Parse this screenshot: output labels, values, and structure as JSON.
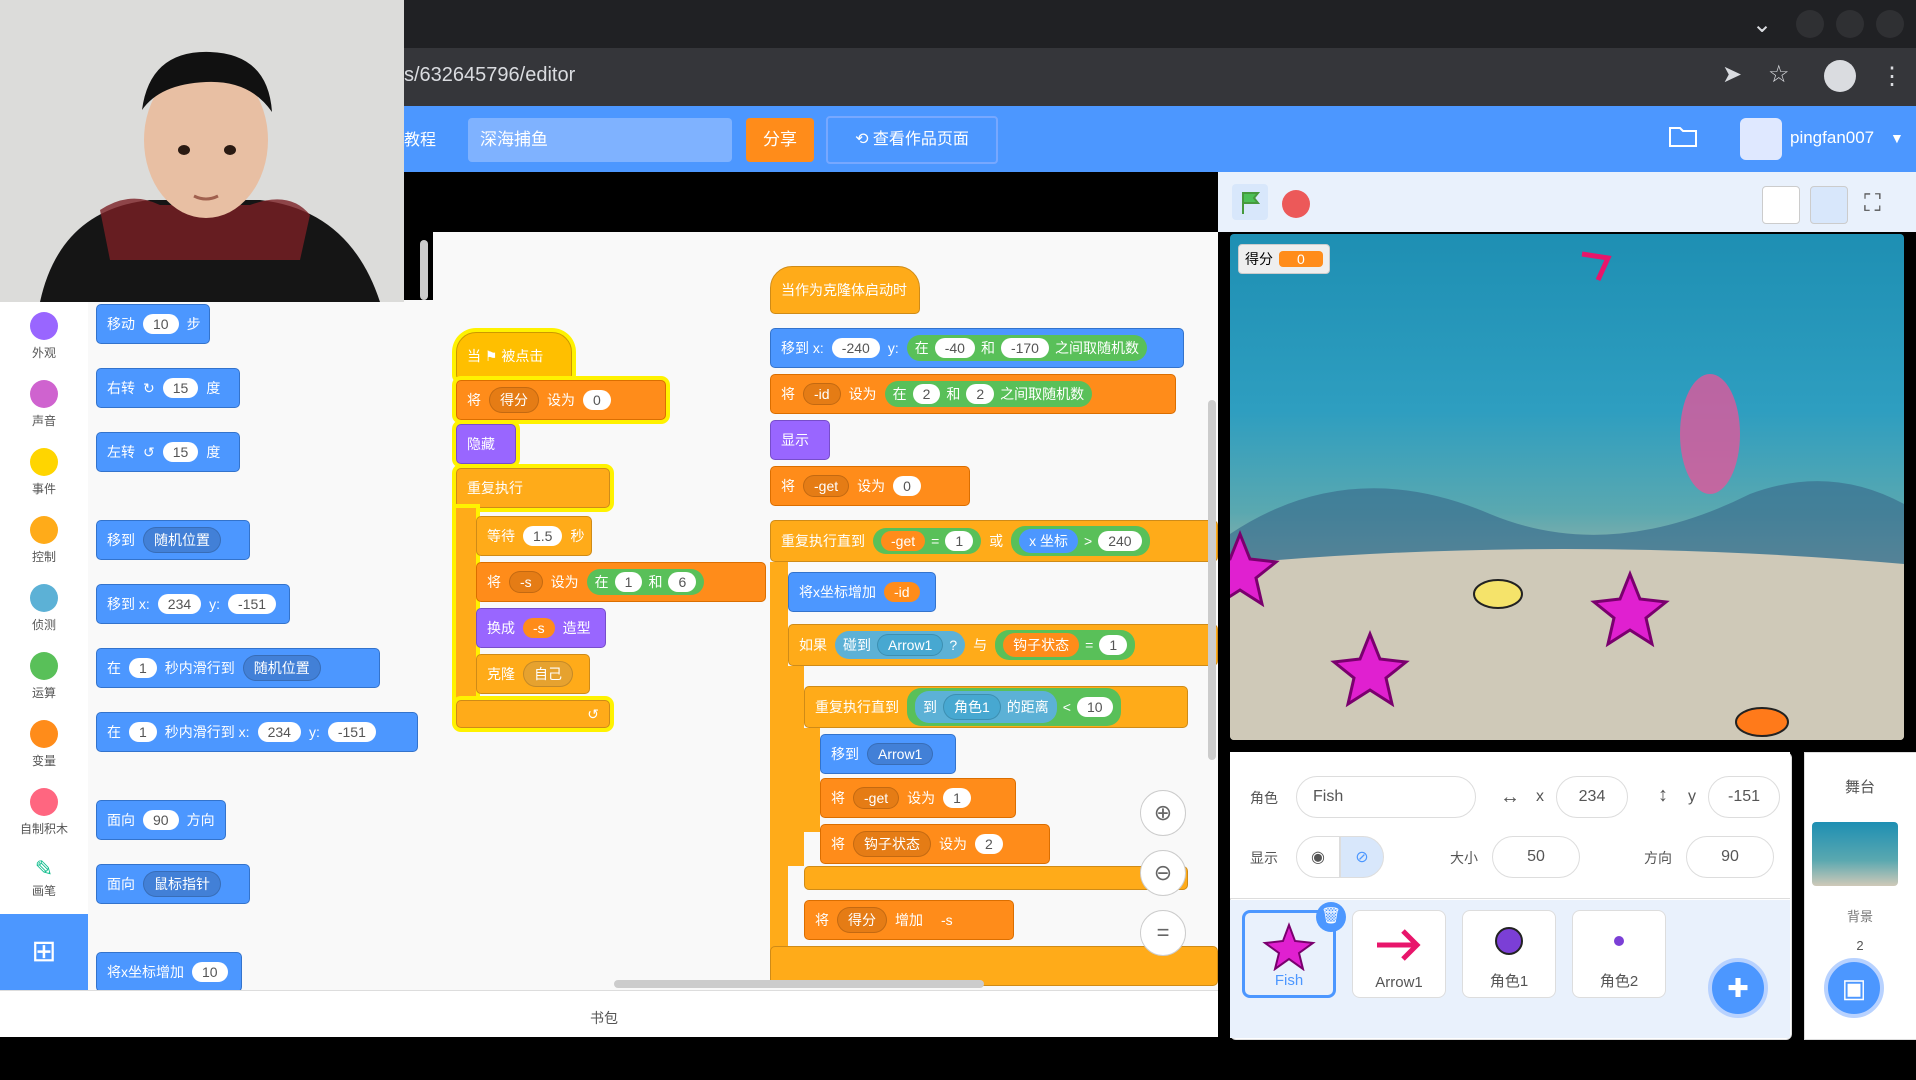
{
  "browser": {
    "url": "s/632645796/editor"
  },
  "menubar": {
    "tutorial": "教程",
    "project_title": "深海捕鱼",
    "share": "分享",
    "see_page": "查看作品页面",
    "username": "pingfan007"
  },
  "categories": [
    {
      "label": "外观",
      "color": "#9966ff"
    },
    {
      "label": "声音",
      "color": "#cf63cf"
    },
    {
      "label": "事件",
      "color": "#ffd500"
    },
    {
      "label": "控制",
      "color": "#ffab19"
    },
    {
      "label": "侦测",
      "color": "#5cb1d6"
    },
    {
      "label": "运算",
      "color": "#59c059"
    },
    {
      "label": "变量",
      "color": "#ff8c1a"
    },
    {
      "label": "自制积木",
      "color": "#ff6680"
    },
    {
      "label": "画笔",
      "color": "#0fbd8c"
    }
  ],
  "palette": {
    "move": {
      "a": "移动",
      "n": "10",
      "b": "步"
    },
    "turn_right": {
      "a": "右转",
      "n": "15",
      "b": "度"
    },
    "turn_left": {
      "a": "左转",
      "n": "15",
      "b": "度"
    },
    "goto": {
      "a": "移到",
      "dd": "随机位置"
    },
    "goto_xy": {
      "a": "移到 x:",
      "x": "234",
      "y_label": "y:",
      "y": "-151"
    },
    "glide": {
      "a": "在",
      "n": "1",
      "b": "秒内滑行到",
      "dd": "随机位置"
    },
    "glide_xy": {
      "a": "在",
      "n": "1",
      "b": "秒内滑行到 x:",
      "x": "234",
      "y_label": "y:",
      "y": "-151"
    },
    "point_dir": {
      "a": "面向",
      "n": "90",
      "b": "方向"
    },
    "point_towards": {
      "a": "面向",
      "dd": "鼠标指针"
    },
    "change_x": {
      "a": "将x坐标增加",
      "n": "10"
    }
  },
  "script1": {
    "hat": "当 ⚑ 被点击",
    "set_var": {
      "a": "将",
      "var": "得分",
      "b": "设为",
      "v": "0"
    },
    "hide": "隐藏",
    "forever": "重复执行",
    "wait": {
      "a": "等待",
      "n": "1.5",
      "b": "秒"
    },
    "set_s": {
      "a": "将",
      "var": "-s",
      "b": "设为",
      "c": "在",
      "n1": "1",
      "d": "和",
      "n2": "6"
    },
    "costume": {
      "a": "换成",
      "v": "-s",
      "b": "造型"
    },
    "clone": {
      "a": "克隆",
      "dd": "自己"
    }
  },
  "script2": {
    "hat": "当作为克隆体启动时",
    "goto": {
      "a": "移到 x:",
      "x": "-240",
      "y_label": "y:",
      "c": "在",
      "n1": "-40",
      "d": "和",
      "n2": "-170",
      "e": "之间取随机数"
    },
    "set_id": {
      "a": "将",
      "var": "-id",
      "b": "设为",
      "c": "在",
      "n1": "2",
      "d": "和",
      "n2": "2",
      "e": "之间取随机数"
    },
    "show": "显示",
    "set_get": {
      "a": "将",
      "var": "-get",
      "b": "设为",
      "v": "0"
    },
    "repeat_until": {
      "a": "重复执行直到",
      "var": "-get",
      "eq": "=",
      "n": "1",
      "or": "或",
      "x": "x 坐标",
      "gt": ">",
      "v": "240"
    },
    "change_x": {
      "a": "将x坐标增加",
      "v": "-id"
    },
    "if": {
      "a": "如果",
      "touch": "碰到",
      "dd": "Arrow1",
      "q": "?",
      "and": "与",
      "var": "钩子状态",
      "eq": "=",
      "n": "1"
    },
    "repeat_until2": {
      "a": "重复执行直到",
      "b": "到",
      "dd": "角色1",
      "c": "的距离",
      "lt": "<",
      "n": "10"
    },
    "goto2": {
      "a": "移到",
      "dd": "Arrow1"
    },
    "set_get1": {
      "a": "将",
      "var": "-get",
      "b": "设为",
      "v": "1"
    },
    "set_hook": {
      "a": "将",
      "var": "钩子状态",
      "b": "设为",
      "v": "2"
    },
    "change_score": {
      "a": "将",
      "var": "得分",
      "b": "增加",
      "v": "-s"
    }
  },
  "stage": {
    "monitor_label": "得分",
    "monitor_value": "0"
  },
  "sprite_info": {
    "label_sprite": "角色",
    "name": "Fish",
    "x_label": "x",
    "x": "234",
    "y_label": "y",
    "y": "-151",
    "label_show": "显示",
    "label_size": "大小",
    "size": "50",
    "label_dir": "方向",
    "direction": "90"
  },
  "sprites": [
    {
      "name": "Fish"
    },
    {
      "name": "Arrow1"
    },
    {
      "name": "角色1"
    },
    {
      "name": "角色2"
    }
  ],
  "stage_pane": {
    "title": "舞台",
    "label": "背景",
    "count": "2"
  },
  "bottom": {
    "backpack": "书包"
  }
}
